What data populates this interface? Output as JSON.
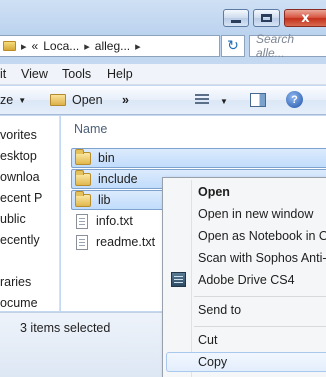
{
  "window": {
    "caption_close": "x"
  },
  "address": {
    "prefix": "«",
    "crumbs": [
      "Loca...",
      "alleg..."
    ],
    "refresh_icon": "refresh-icon",
    "search_placeholder": "Search alle..."
  },
  "menubar": {
    "items": [
      "it",
      "View",
      "Tools",
      "Help"
    ]
  },
  "cmdbar": {
    "organize_label": "ze",
    "open_label": "Open",
    "more_label": "»"
  },
  "nav": {
    "items": [
      "vorites",
      "esktop",
      "ownloa",
      "ecent P",
      "ublic",
      "ecently",
      "raries",
      "ocume"
    ]
  },
  "content": {
    "column_header": "Name",
    "files": [
      {
        "name": "bin",
        "type": "folder",
        "selected": true
      },
      {
        "name": "include",
        "type": "folder",
        "selected": true
      },
      {
        "name": "lib",
        "type": "folder",
        "selected": true
      },
      {
        "name": "info.txt",
        "type": "file",
        "selected": false
      },
      {
        "name": "readme.txt",
        "type": "file",
        "selected": false
      }
    ]
  },
  "status": {
    "selection_text": "3 items selected"
  },
  "context_menu": {
    "items": [
      {
        "label": "Open",
        "bold": true
      },
      {
        "label": "Open in new window"
      },
      {
        "label": "Open as Notebook in On"
      },
      {
        "label": "Scan with Sophos Anti-V"
      },
      {
        "label": "Adobe Drive CS4"
      },
      {
        "label": "Send to"
      },
      {
        "label": "Cut"
      },
      {
        "label": "Copy",
        "hovered": true
      }
    ]
  },
  "colors": {
    "selection": "#c1dcfc",
    "chrome": "#bcd3ef",
    "close_button": "#c4301b"
  }
}
